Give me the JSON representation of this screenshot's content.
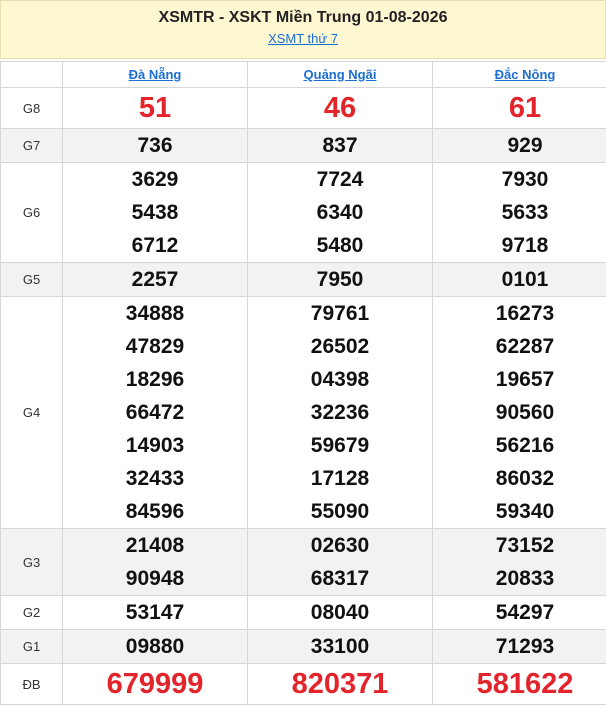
{
  "header": {
    "title": "XSMTR - XSKT Miền Trung 01-08-2026",
    "link": "XSMT thứ 7"
  },
  "provinces": [
    "Đà Nẵng",
    "Quảng Ngãi",
    "Đắc Nông"
  ],
  "prizes": [
    {
      "label": "G8",
      "values": [
        [
          "51"
        ],
        [
          "46"
        ],
        [
          "61"
        ]
      ]
    },
    {
      "label": "G7",
      "values": [
        [
          "736"
        ],
        [
          "837"
        ],
        [
          "929"
        ]
      ]
    },
    {
      "label": "G6",
      "values": [
        [
          "3629",
          "5438",
          "6712"
        ],
        [
          "7724",
          "6340",
          "5480"
        ],
        [
          "7930",
          "5633",
          "9718"
        ]
      ]
    },
    {
      "label": "G5",
      "values": [
        [
          "2257"
        ],
        [
          "7950"
        ],
        [
          "0101"
        ]
      ]
    },
    {
      "label": "G4",
      "values": [
        [
          "34888",
          "47829",
          "18296",
          "66472",
          "14903",
          "32433",
          "84596"
        ],
        [
          "79761",
          "26502",
          "04398",
          "32236",
          "59679",
          "17128",
          "55090"
        ],
        [
          "16273",
          "62287",
          "19657",
          "90560",
          "56216",
          "86032",
          "59340"
        ]
      ]
    },
    {
      "label": "G3",
      "values": [
        [
          "21408",
          "90948"
        ],
        [
          "02630",
          "68317"
        ],
        [
          "73152",
          "20833"
        ]
      ]
    },
    {
      "label": "G2",
      "values": [
        [
          "53147"
        ],
        [
          "08040"
        ],
        [
          "54297"
        ]
      ]
    },
    {
      "label": "G1",
      "values": [
        [
          "09880"
        ],
        [
          "33100"
        ],
        [
          "71293"
        ]
      ]
    },
    {
      "label": "ĐB",
      "values": [
        [
          "679999"
        ],
        [
          "820371"
        ],
        [
          "581622"
        ]
      ]
    }
  ],
  "colors": {
    "header_bg": "#fdf7d2",
    "link": "#1a6fd6",
    "highlight_red": "#e3242b",
    "alt_row": "#f2f2f2"
  }
}
